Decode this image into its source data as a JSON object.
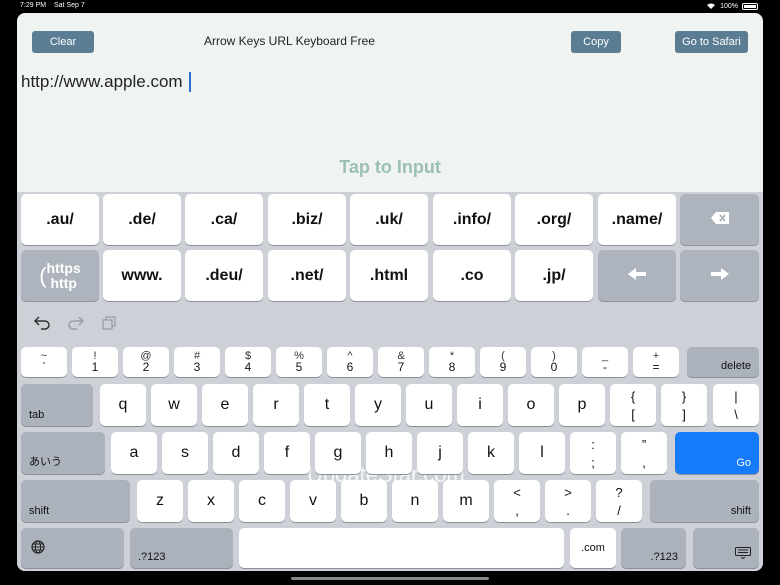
{
  "status": {
    "time": "7:29 PM",
    "date": "Sat Sep 7",
    "battery": "100%"
  },
  "toolbar": {
    "clear_label": "Clear",
    "title": "Arrow Keys URL Keyboard Free",
    "copy_label": "Copy",
    "safari_label": "Go to Safari"
  },
  "editor": {
    "url_text": "http://www.apple.com"
  },
  "tap_label": "Tap to Input",
  "custom_keys": {
    "row1": [
      ".au/",
      ".de/",
      ".ca/",
      ".biz/",
      ".uk/",
      ".info/",
      ".org/",
      ".name/"
    ],
    "row2": [
      ".www.",
      ".deu/",
      ".net/",
      ".html",
      ".co",
      ".jp/"
    ],
    "www": "www.",
    "https_label": "https",
    "http_label": "http",
    "backspace_icon": "backspace-icon",
    "left_icon": "arrow-left-icon",
    "right_icon": "arrow-right-icon"
  },
  "watermark": "UpdateStar.com",
  "keyboard": {
    "number_row": [
      {
        "top": "~",
        "bottom": "`"
      },
      {
        "top": "!",
        "bottom": "1"
      },
      {
        "top": "@",
        "bottom": "2"
      },
      {
        "top": "#",
        "bottom": "3"
      },
      {
        "top": "$",
        "bottom": "4"
      },
      {
        "top": "%",
        "bottom": "5"
      },
      {
        "top": "^",
        "bottom": "6"
      },
      {
        "top": "&",
        "bottom": "7"
      },
      {
        "top": "*",
        "bottom": "8"
      },
      {
        "top": "(",
        "bottom": "9"
      },
      {
        "top": ")",
        "bottom": "0"
      },
      {
        "top": "_",
        "bottom": "-"
      },
      {
        "top": "+",
        "bottom": "="
      }
    ],
    "delete_label": "delete",
    "tab_label": "tab",
    "row_q": [
      "q",
      "w",
      "e",
      "r",
      "t",
      "y",
      "u",
      "i",
      "o",
      "p"
    ],
    "bracket_keys": [
      {
        "top": "{",
        "bottom": "["
      },
      {
        "top": "}",
        "bottom": "]"
      },
      {
        "top": "|",
        "bottom": "\\"
      }
    ],
    "kana_label": "あいう",
    "row_a": [
      "a",
      "s",
      "d",
      "f",
      "g",
      "h",
      "j",
      "k",
      "l"
    ],
    "punct_keys_a": [
      {
        "top": ":",
        "bottom": ";"
      },
      {
        "top": "”",
        "bottom": ","
      }
    ],
    "go_label": "Go",
    "shift_label": "shift",
    "row_z": [
      "z",
      "x",
      "c",
      "v",
      "b",
      "n",
      "m"
    ],
    "punct_keys_z": [
      {
        "top": "<",
        "bottom": ","
      },
      {
        "top": ">",
        "bottom": "."
      },
      {
        "top": "?",
        "bottom": "/"
      }
    ],
    "num_switch_label": ".?123",
    "dotcom_label": ".com"
  },
  "colors": {
    "accent": "#157bfb",
    "button": "#5b7d94",
    "tap_hint": "#9bbfb3"
  }
}
